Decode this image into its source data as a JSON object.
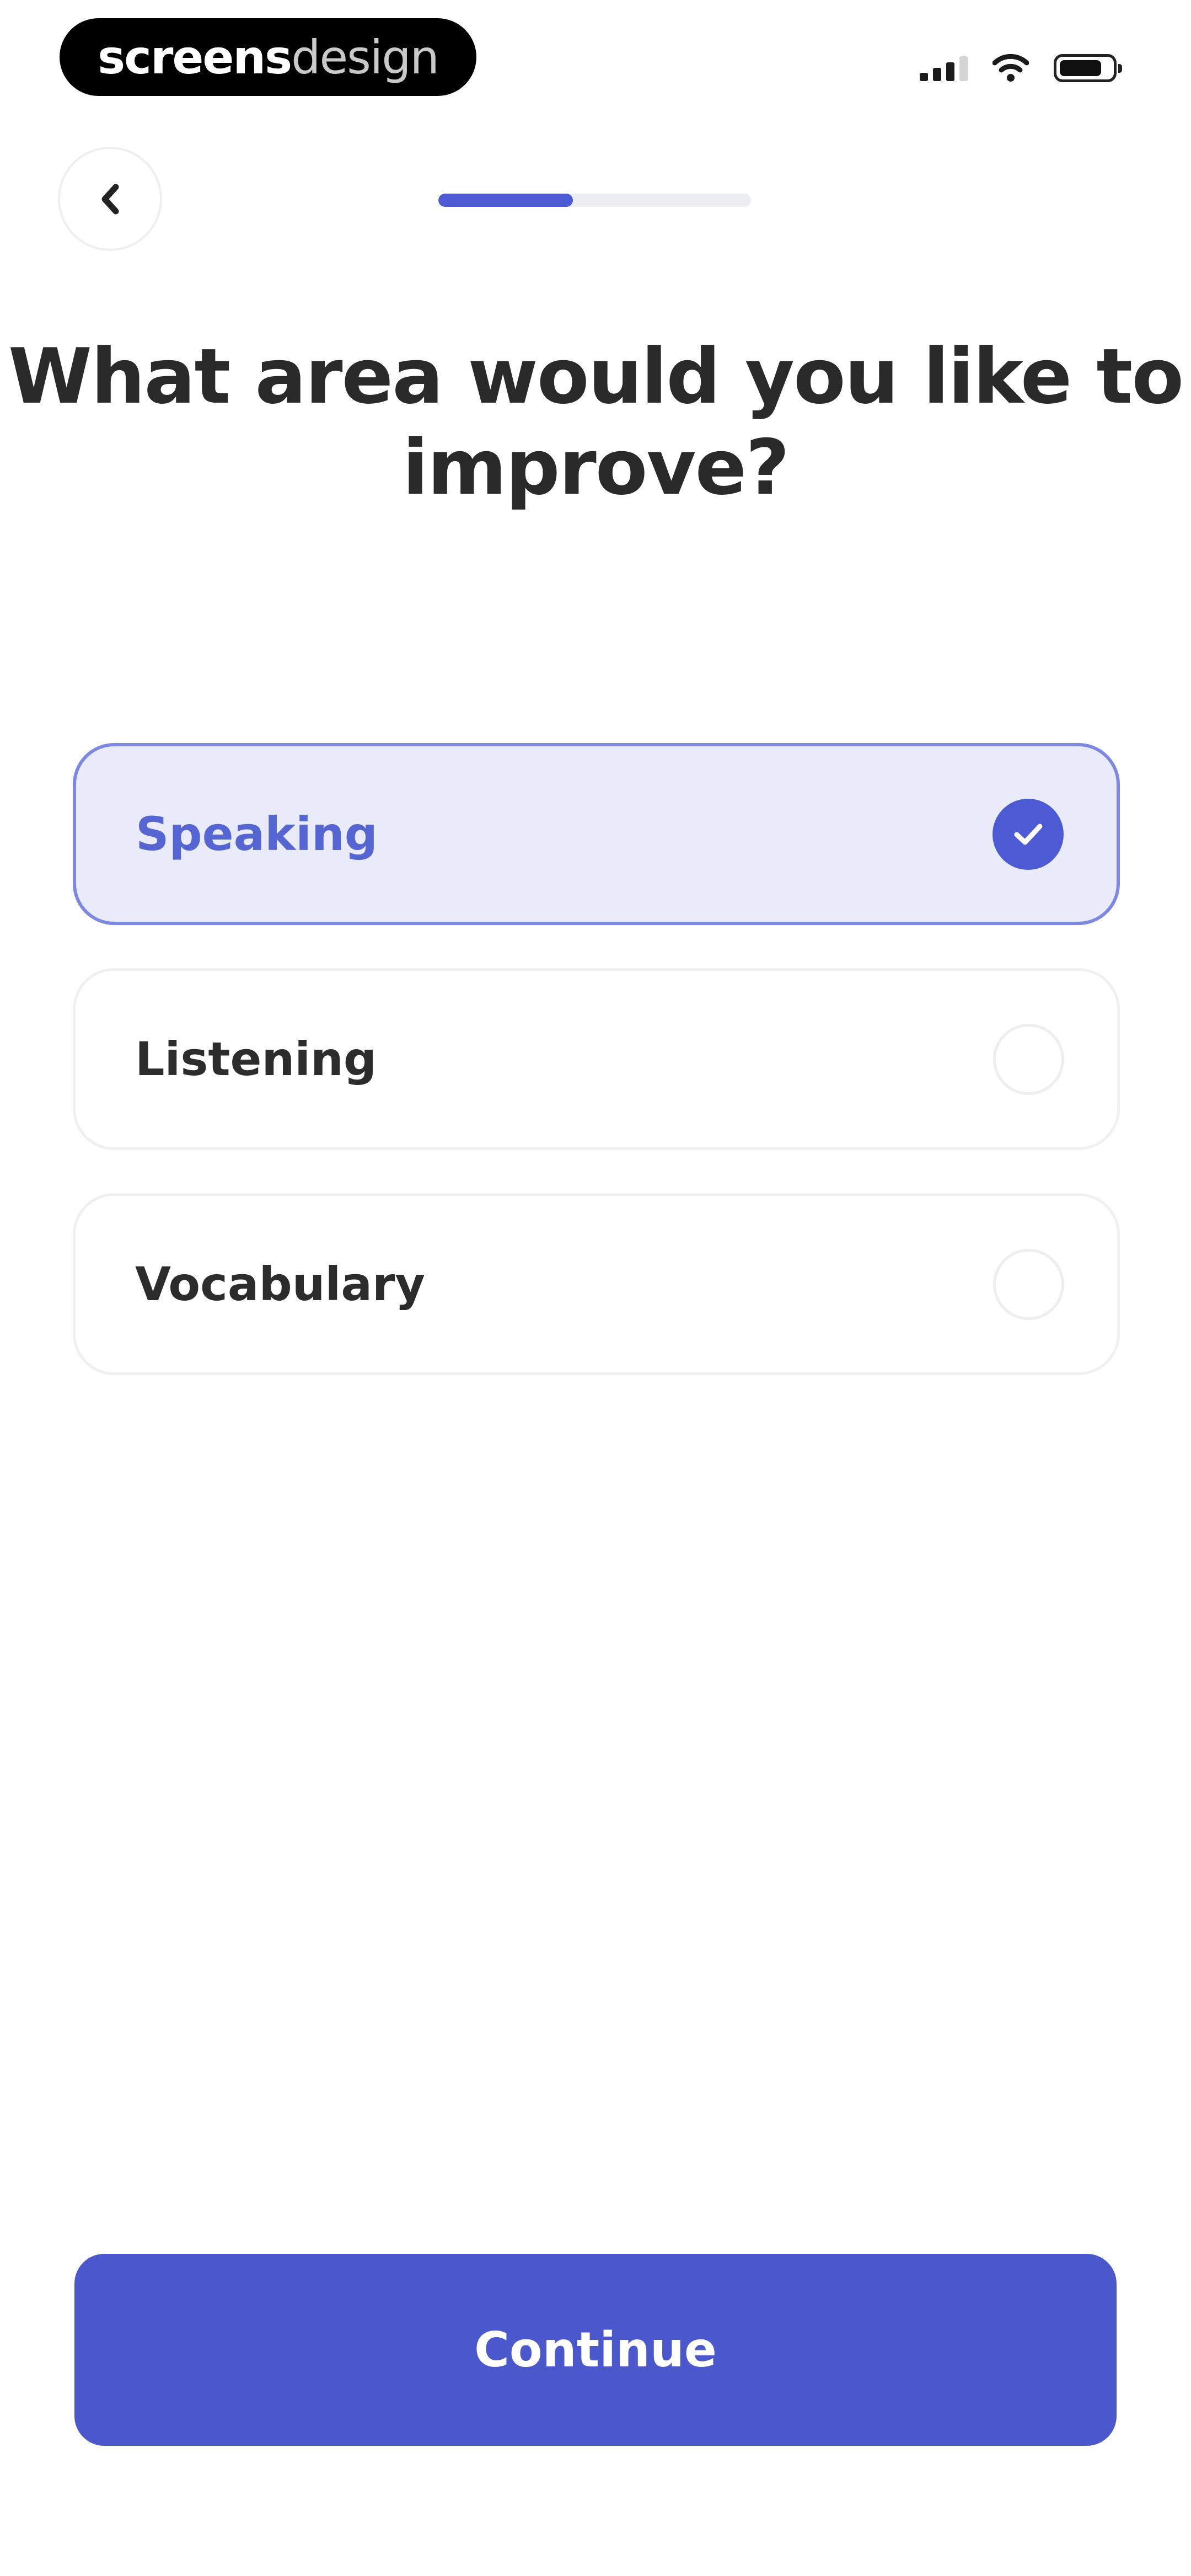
{
  "brand": {
    "bold_text": "screens",
    "light_text": "design"
  },
  "status_bar": {
    "signal_icon": "cellular-signal-icon",
    "wifi_icon": "wifi-icon",
    "battery_icon": "battery-icon"
  },
  "nav": {
    "back_icon": "chevron-left-icon",
    "progress": 0.43
  },
  "title": "What area would you like to improve?",
  "options": [
    {
      "label": "Speaking",
      "selected": true
    },
    {
      "label": "Listening",
      "selected": false
    },
    {
      "label": "Vocabulary",
      "selected": false
    }
  ],
  "continue_label": "Continue",
  "colors": {
    "accent": "#4c5bd4",
    "selected_bg": "#e9ebfb",
    "selected_text": "#5565d2",
    "title_text": "#2a2a2a"
  }
}
